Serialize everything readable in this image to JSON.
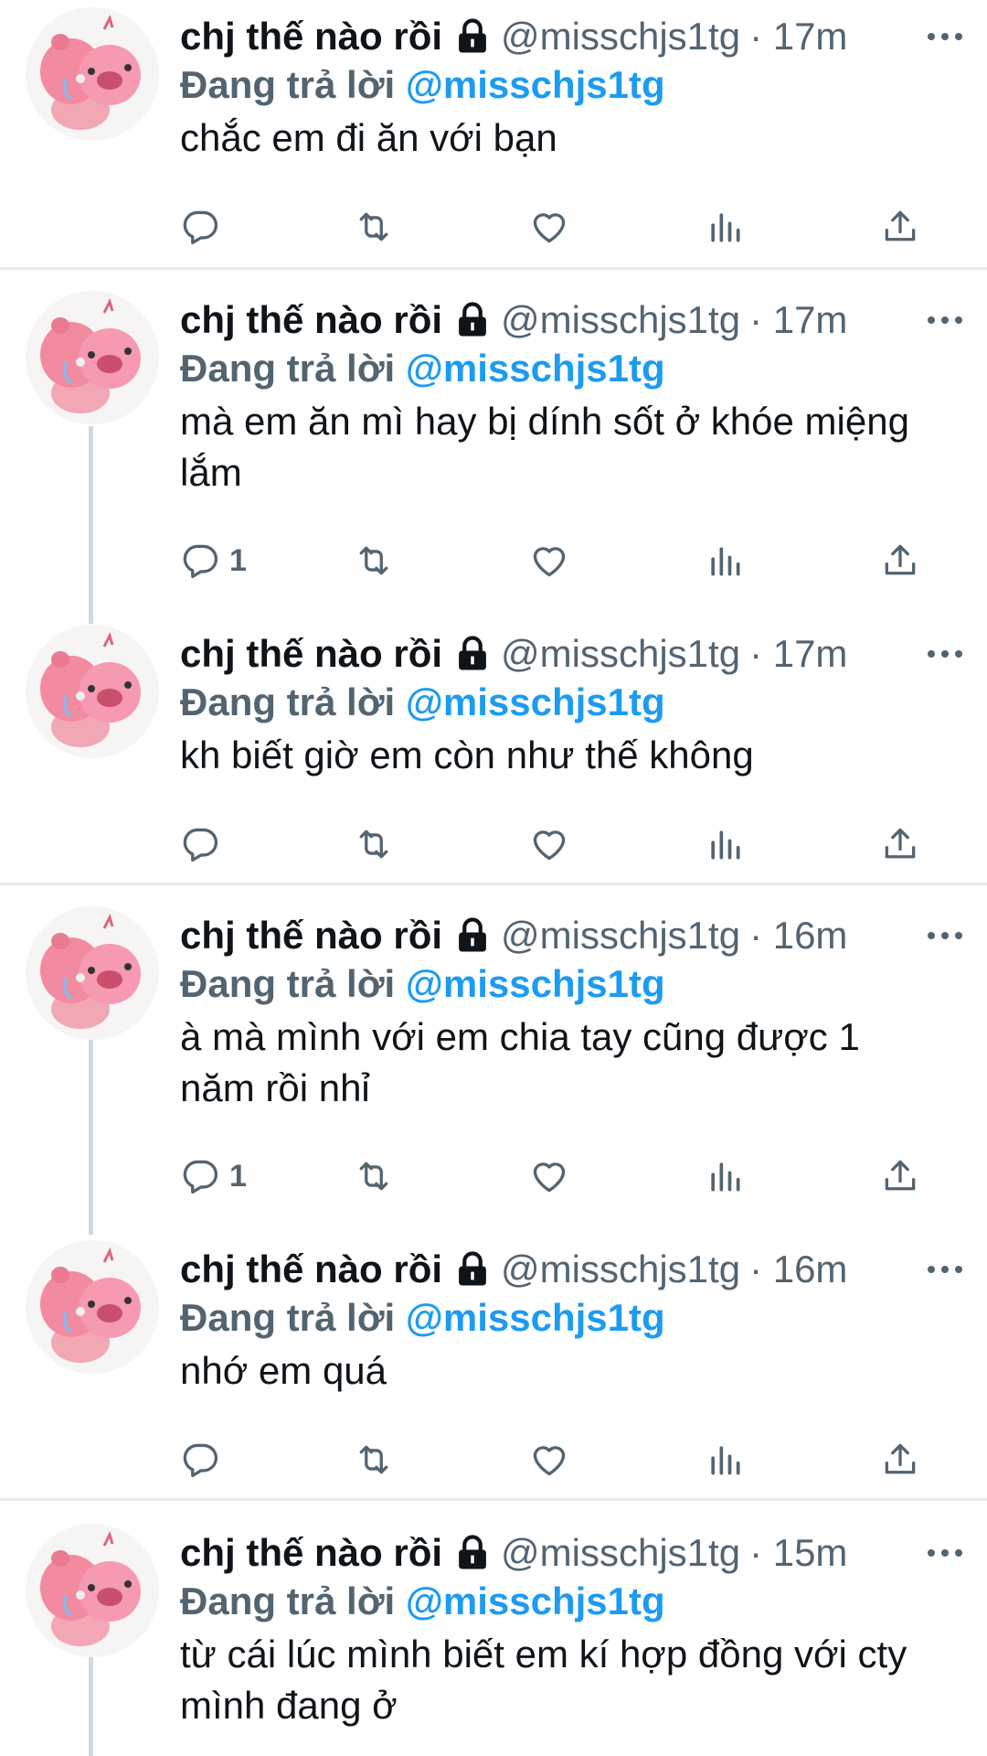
{
  "colors": {
    "accent": "#1d9bf0",
    "muted": "#536471",
    "text": "#0f1419",
    "border": "#e6ecf0"
  },
  "tweets": [
    {
      "name": "chj thế nào rồi",
      "handle": "@misschjs1tg",
      "time": "· 17m",
      "replying_label": "Đang trả lời",
      "replying_to": "@misschjs1tg",
      "text": "chắc em đi ăn với bạn",
      "reply_count": ""
    },
    {
      "name": "chj thế nào rồi",
      "handle": "@misschjs1tg",
      "time": "· 17m",
      "replying_label": "Đang trả lời",
      "replying_to": "@misschjs1tg",
      "text": "mà em ăn mì hay bị dính sốt ở khóe miệng lắm",
      "reply_count": "1"
    },
    {
      "name": "chj thế nào rồi",
      "handle": "@misschjs1tg",
      "time": "· 17m",
      "replying_label": "Đang trả lời",
      "replying_to": "@misschjs1tg",
      "text": "kh biết giờ em còn như thế không",
      "reply_count": ""
    },
    {
      "name": "chj thế nào rồi",
      "handle": "@misschjs1tg",
      "time": "· 16m",
      "replying_label": "Đang trả lời",
      "replying_to": "@misschjs1tg",
      "text": "à mà mình với em chia tay cũng được 1 năm rồi nhỉ",
      "reply_count": "1"
    },
    {
      "name": "chj thế nào rồi",
      "handle": "@misschjs1tg",
      "time": "· 16m",
      "replying_label": "Đang trả lời",
      "replying_to": "@misschjs1tg",
      "text": "nhớ em quá",
      "reply_count": ""
    },
    {
      "name": "chj thế nào rồi",
      "handle": "@misschjs1tg",
      "time": "· 15m",
      "replying_label": "Đang trả lời",
      "replying_to": "@misschjs1tg",
      "text": "từ cái lúc mình biết em kí hợp đồng với cty mình đang ở",
      "reply_count": ""
    }
  ]
}
